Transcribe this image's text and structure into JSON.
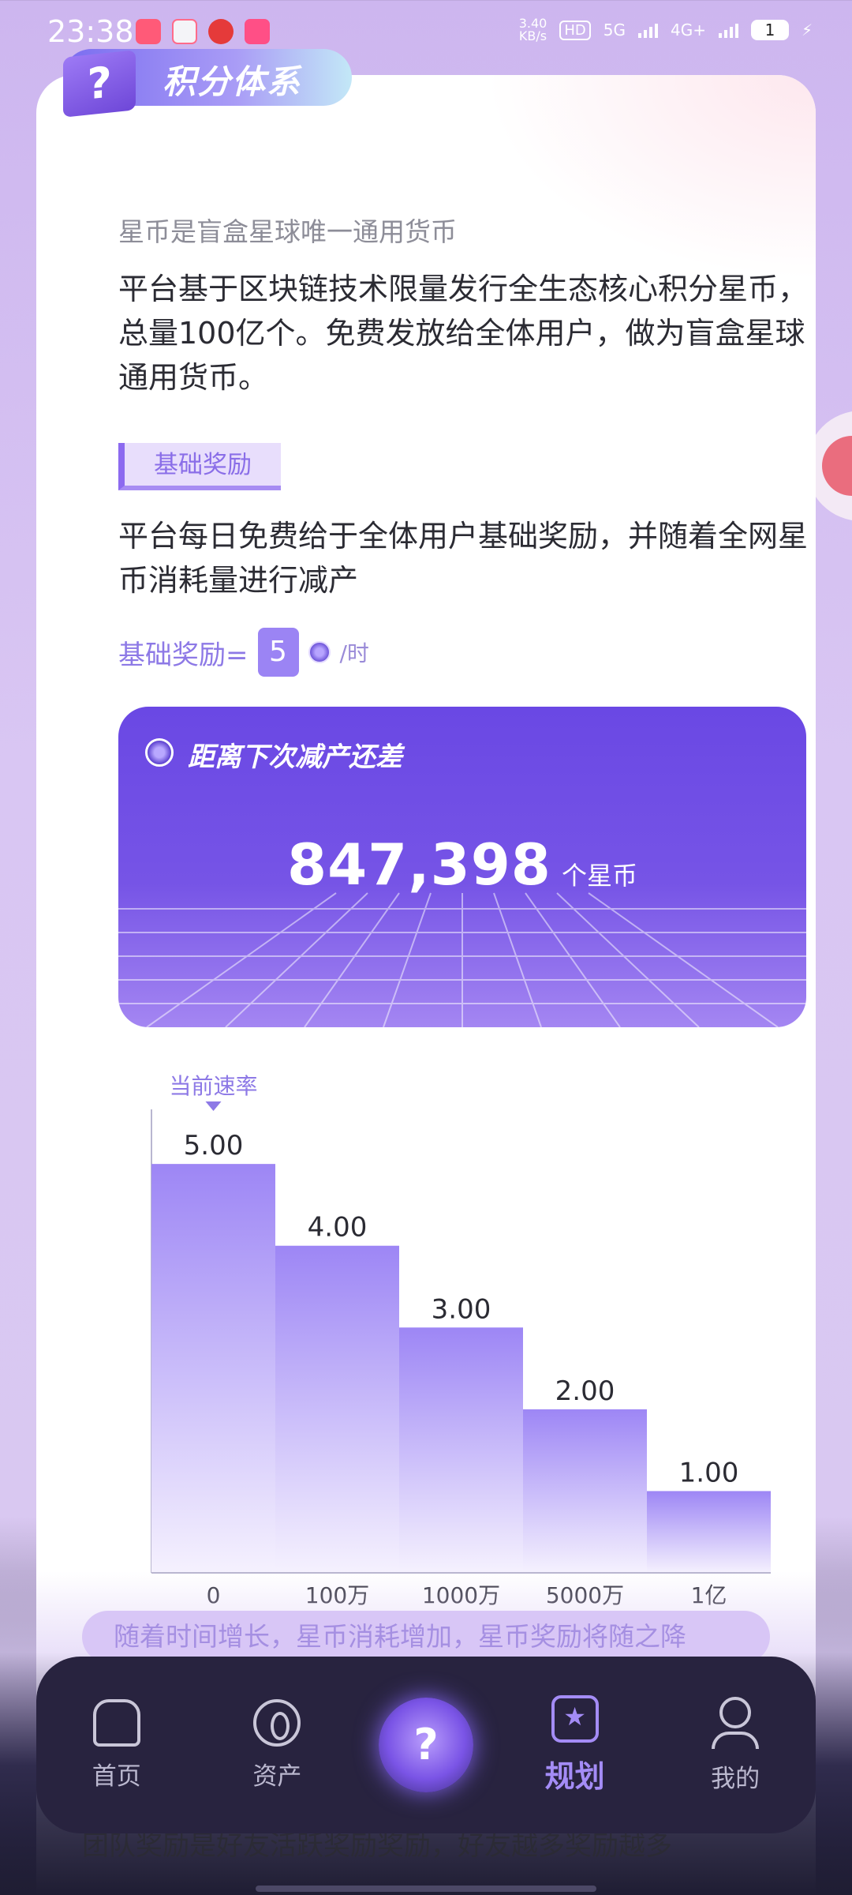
{
  "status_bar": {
    "time": "23:38",
    "net_speed_value": "3.40",
    "net_speed_unit": "KB/s",
    "hd": "HD",
    "network_5g": "5G",
    "network_4g": "4G+",
    "battery": "1"
  },
  "header": {
    "title": "积分体系",
    "box_symbol": "?"
  },
  "intro": {
    "subtitle": "星币是盲盒星球唯一通用货币",
    "text": "平台基于区块链技术限量发行全生态核心积分星币，总量100亿个。免费发放给全体用户，做为盲盒星球通用货币。"
  },
  "base_reward": {
    "tag": "基础奖励",
    "description": "平台每日免费给于全体用户基础奖励，并随着全网星币消耗量进行减产",
    "formula_label": "基础奖励=",
    "formula_value": "5",
    "formula_unit": "/时"
  },
  "banner": {
    "title": "距离下次减产还差",
    "value": "847,398",
    "unit": "个星币"
  },
  "chart_data": {
    "type": "bar",
    "title": "",
    "marker_label": "当前速率",
    "categories": [
      "0",
      "100万",
      "1000万",
      "5000万",
      "1亿"
    ],
    "values": [
      5.0,
      4.0,
      3.0,
      2.0,
      1.0
    ],
    "value_labels": [
      "5.00",
      "4.00",
      "3.00",
      "2.00",
      "1.00"
    ],
    "ylim": [
      0,
      5.6
    ],
    "colors": {
      "bar_top": "#9d86f5",
      "bar_bottom": "#f5f1fe",
      "axis": "#b9b6d0"
    }
  },
  "caption": "随着时间增长，星币消耗增加，星币奖励将随之降",
  "hidden_line": "团队奖励是好友活跃奖励奖励，好友越多奖励越多",
  "nav": {
    "items": [
      {
        "label": "首页"
      },
      {
        "label": "资产"
      },
      {
        "label": "规划"
      },
      {
        "label": "我的"
      }
    ],
    "center_symbol": "?"
  }
}
